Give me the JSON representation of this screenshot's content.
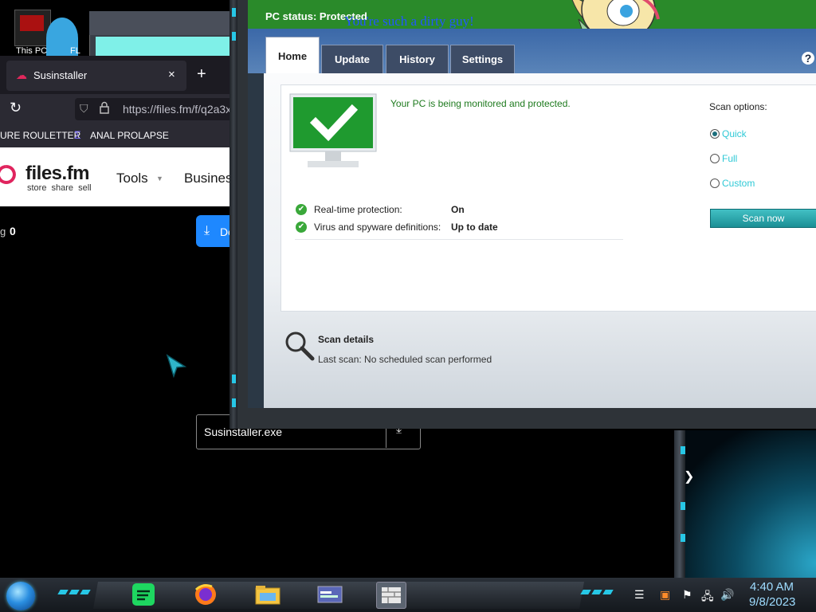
{
  "desktop": {
    "icons": [
      {
        "label": "This PC"
      },
      {
        "label": "FL"
      }
    ]
  },
  "browser": {
    "tab": {
      "title": "Susinstaller",
      "close": "×"
    },
    "new_tab": "+",
    "url": "https://files.fm/f/q2a3x",
    "bookmarks": [
      {
        "label": "URE ROULETTER"
      },
      {
        "label": "ANAL PROLAPSE"
      }
    ],
    "site": {
      "logo": "files.fm",
      "tagline": "store  share  sell",
      "nav": [
        {
          "label": "Tools"
        },
        {
          "label": "Business"
        }
      ],
      "stat_label": "g",
      "stat_value": "0",
      "download_label": "Dov"
    },
    "download_item": {
      "filename": "Susinstaller.exe"
    }
  },
  "mse": {
    "status": "PC status: Protected",
    "overlay_text": "You're such a dirty guy!",
    "tabs": [
      {
        "label": "Home",
        "active": true
      },
      {
        "label": "Update",
        "active": false
      },
      {
        "label": "History",
        "active": false
      },
      {
        "label": "Settings",
        "active": false
      }
    ],
    "help": "?",
    "protected_message": "Your PC is being monitored and protected.",
    "rows": [
      {
        "label": "Real-time protection:",
        "value": "On"
      },
      {
        "label": "Virus and spyware definitions:",
        "value": "Up to date"
      }
    ],
    "scan_options_label": "Scan options:",
    "scan_options": [
      {
        "label": "Quick",
        "selected": true
      },
      {
        "label": "Full",
        "selected": false
      },
      {
        "label": "Custom",
        "selected": false
      }
    ],
    "scan_button": "Scan now",
    "scan_details_title": "Scan details",
    "last_scan": "Last scan:  No scheduled scan performed",
    "colors": {
      "header": "#2a8a2a",
      "accent": "#2fc9d6"
    }
  },
  "taskbar": {
    "apps": [
      {
        "icon": "spotify-icon"
      },
      {
        "icon": "firefox-icon"
      },
      {
        "icon": "file-explorer-icon"
      },
      {
        "icon": "window-app-icon"
      },
      {
        "icon": "security-essentials-icon"
      }
    ],
    "clock": {
      "time": "4:40 AM",
      "date": "9/8/2023"
    }
  }
}
